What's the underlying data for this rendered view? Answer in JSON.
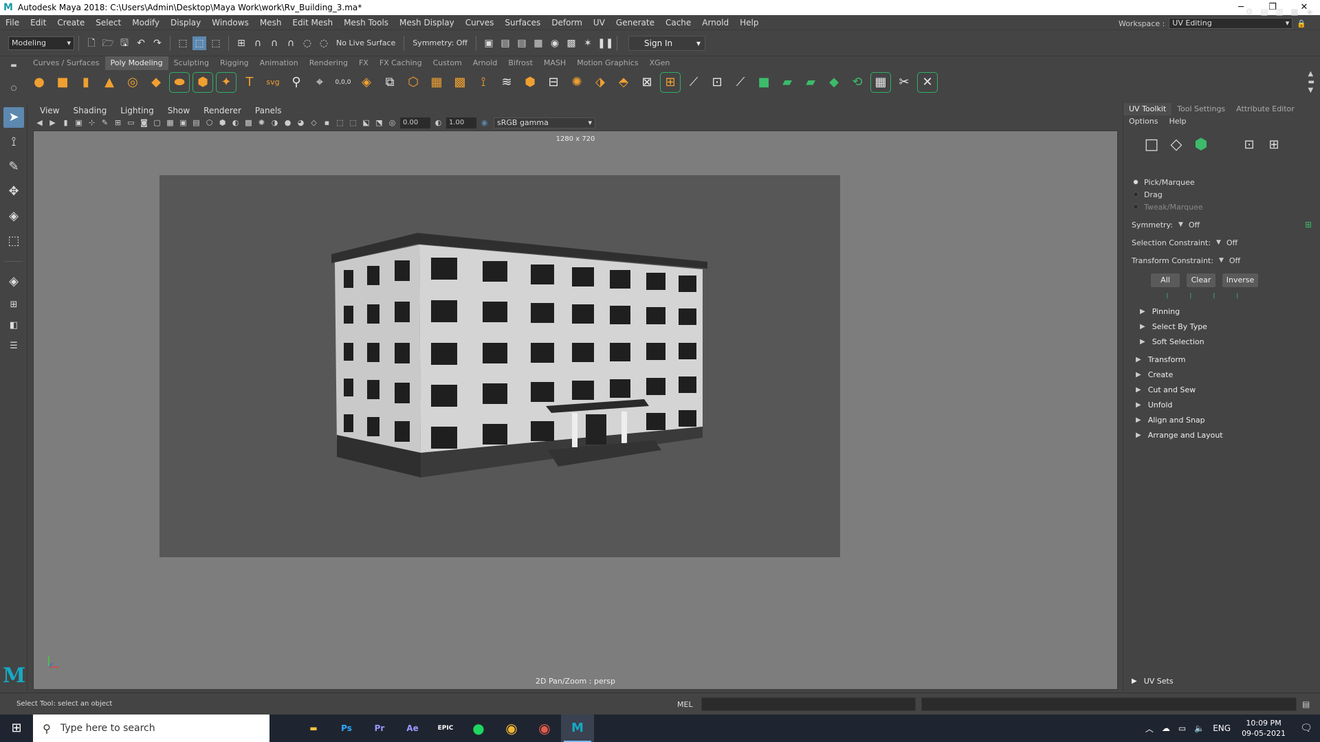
{
  "window": {
    "title": "Autodesk Maya 2018: C:\\Users\\Admin\\Desktop\\Maya Work\\work\\Rv_Building_3.ma*",
    "controls": [
      "─",
      "❐",
      "✕"
    ]
  },
  "menubar": {
    "items": [
      "File",
      "Edit",
      "Create",
      "Select",
      "Modify",
      "Display",
      "Windows",
      "Mesh",
      "Edit Mesh",
      "Mesh Tools",
      "Mesh Display",
      "Curves",
      "Surfaces",
      "Deform",
      "UV",
      "Generate",
      "Cache",
      "Arnold",
      "Help"
    ]
  },
  "workspace": {
    "label": "Workspace :",
    "value": "UV Editing"
  },
  "statusline": {
    "mode": "Modeling",
    "live_surface": "No Live Surface",
    "symmetry": "Symmetry: Off",
    "sign_in": "Sign In"
  },
  "shelf": {
    "tabs": [
      "Curves / Surfaces",
      "Poly Modeling",
      "Sculpting",
      "Rigging",
      "Animation",
      "Rendering",
      "FX",
      "FX Caching",
      "Custom",
      "Arnold",
      "Bifrost",
      "MASH",
      "Motion Graphics",
      "XGen"
    ],
    "active_tab": "Poly Modeling",
    "svg_label": "svg",
    "coord_label": "0,0,0"
  },
  "viewport": {
    "panel_menu": [
      "View",
      "Shading",
      "Lighting",
      "Show",
      "Renderer",
      "Panels"
    ],
    "exposure": "0.00",
    "gamma_value": "1.00",
    "color_space": "sRGB gamma",
    "resolution": "1280 x 720",
    "camera_label": "2D Pan/Zoom : persp"
  },
  "right_panel": {
    "tabs": [
      "UV Toolkit",
      "Tool Settings",
      "Attribute Editor"
    ],
    "menu": [
      "Options",
      "Help"
    ],
    "modes": [
      {
        "label": "Pick/Marquee",
        "selected": true
      },
      {
        "label": "Drag",
        "selected": false
      },
      {
        "label": "Tweak/Marquee",
        "selected": false
      }
    ],
    "symmetry_label": "Symmetry:",
    "symmetry_value": "Off",
    "selection_constraint_label": "Selection Constraint:",
    "selection_constraint_value": "Off",
    "transform_constraint_label": "Transform Constraint:",
    "transform_constraint_value": "Off",
    "buttons": [
      "All",
      "Clear",
      "Inverse"
    ],
    "sub_sections": [
      "Pinning",
      "Select By Type",
      "Soft Selection"
    ],
    "sections": [
      "Transform",
      "Create",
      "Cut and Sew",
      "Unfold",
      "Align and Snap",
      "Arrange and Layout"
    ],
    "uv_sets": "UV Sets"
  },
  "helpline": {
    "text": "Select Tool: select an object",
    "command_type": "MEL"
  },
  "taskbar": {
    "search_placeholder": "Type here to search",
    "apps": [
      {
        "name": "file-explorer",
        "label": "▬",
        "color": "#f5c242"
      },
      {
        "name": "photoshop",
        "label": "Ps",
        "color": "#31a8ff"
      },
      {
        "name": "premiere",
        "label": "Pr",
        "color": "#9999ff"
      },
      {
        "name": "after-effects",
        "label": "Ae",
        "color": "#9999ff"
      },
      {
        "name": "epic-games",
        "label": "EPIC",
        "color": "#ffffff"
      },
      {
        "name": "spotify",
        "label": "●",
        "color": "#1ed760"
      },
      {
        "name": "chrome",
        "label": "◉",
        "color": "#f2b632"
      },
      {
        "name": "chrome-profile",
        "label": "◉",
        "color": "#e25b4b"
      },
      {
        "name": "maya",
        "label": "M",
        "color": "#16a9c3"
      }
    ],
    "language": "ENG",
    "time": "10:09 PM",
    "date": "09-05-2021"
  }
}
